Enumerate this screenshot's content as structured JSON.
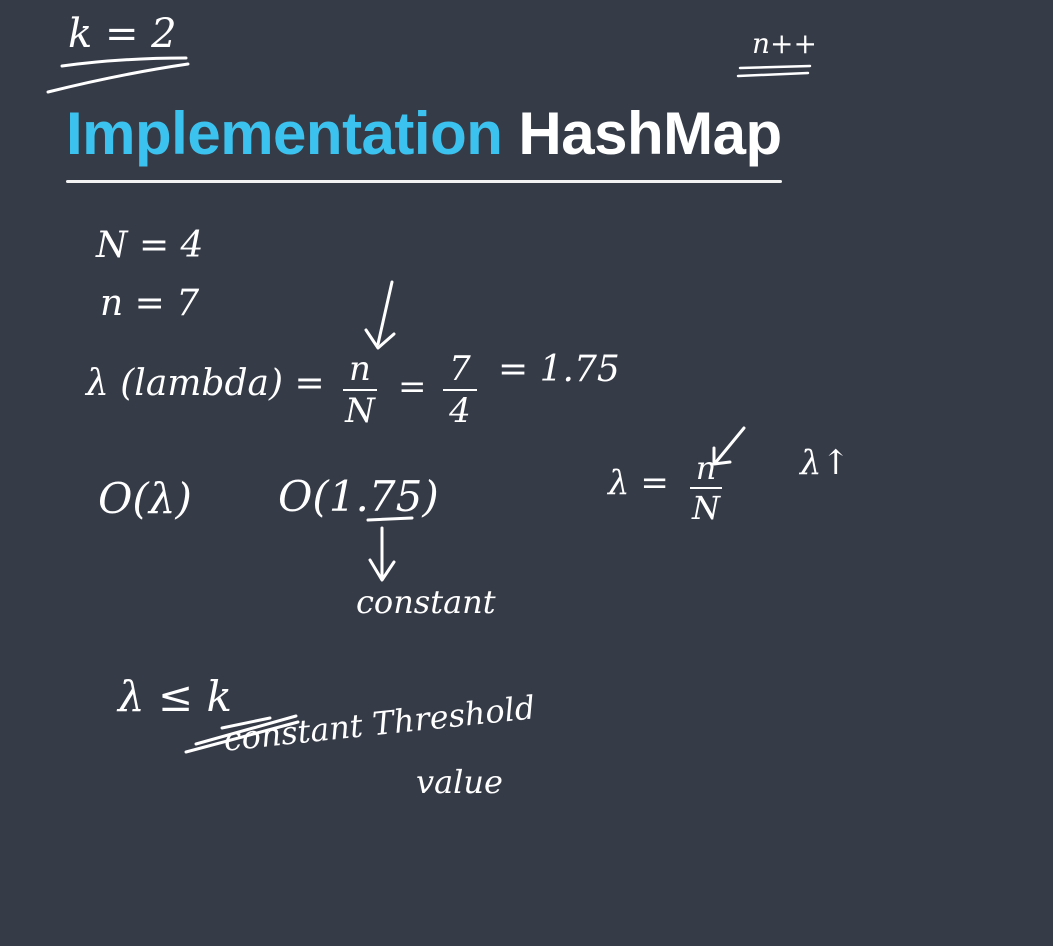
{
  "note": {
    "k_value": "k = 2",
    "n_plus_plus": "n++",
    "title_part1": "Implementation",
    "title_part2": "HashMap",
    "N_eq": "N = 4",
    "n_eq": "n = 7",
    "lambda_label": "λ (lambda) =",
    "frac1_num": "n",
    "frac1_den": "N",
    "eq_sign": "=",
    "frac2_num": "7",
    "frac2_den": "4",
    "result": "= 1.75",
    "big_o_lambda": "O(λ)",
    "big_o_value": "O(1.75)",
    "constant_label": "constant",
    "lambda_eq_right": "λ =",
    "frac3_num": "n",
    "frac3_den": "N",
    "lambda_up": "λ↑",
    "lambda_le": "λ ≤ k",
    "threshold_label": "constant Threshold",
    "value_label": "value"
  }
}
